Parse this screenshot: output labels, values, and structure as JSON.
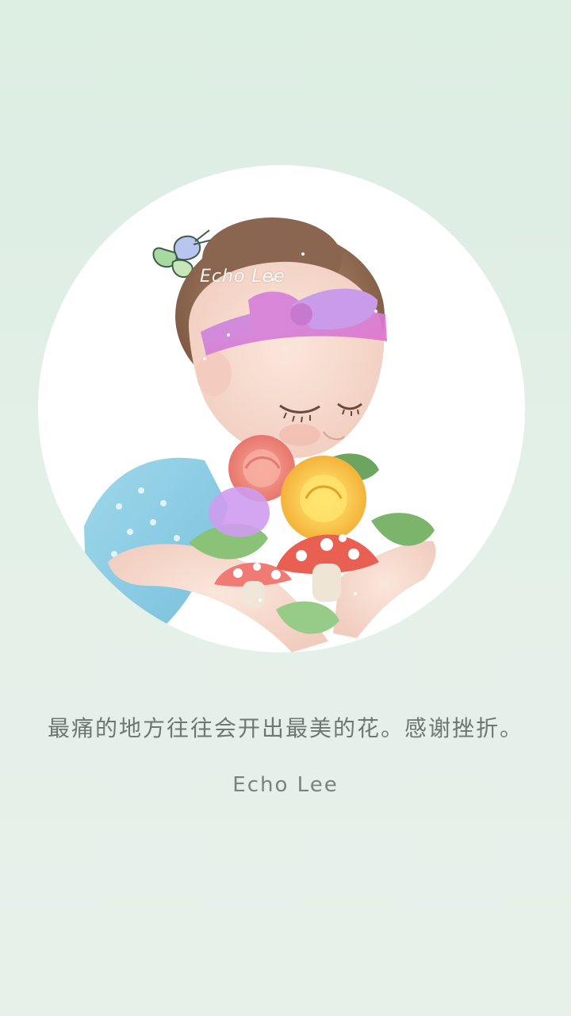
{
  "artwork": {
    "watermark": "Echo Lee",
    "subject": "girl-with-flowers-illustration"
  },
  "quote": {
    "text": "最痛的地方往往会开出最美的花。感谢挫折。"
  },
  "author": {
    "name": "Echo Lee"
  },
  "colors": {
    "background": "#e1efe6",
    "circle": "#ffffff",
    "text": "#6f7673"
  }
}
